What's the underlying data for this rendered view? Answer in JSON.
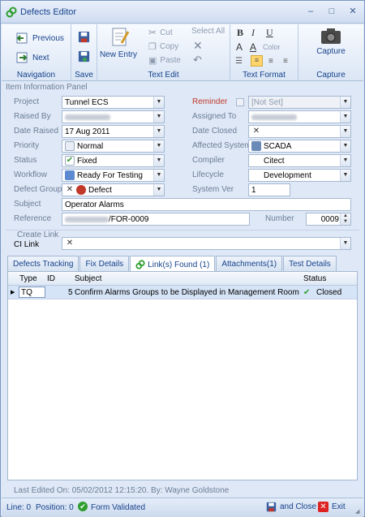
{
  "window": {
    "title": "Defects Editor",
    "controls": [
      "–",
      "□",
      "✕"
    ]
  },
  "ribbon": {
    "navigation": {
      "label": "Navigation",
      "previous": "Previous",
      "next": "Next"
    },
    "save": {
      "label": "Save"
    },
    "text_edit": {
      "label": "Text Edit",
      "new_entry": "New Entry",
      "cut": "Cut",
      "copy": "Copy",
      "paste": "Paste",
      "select_all": "Select All"
    },
    "text_format": {
      "label": "Text Format",
      "bold": "B",
      "italic": "I",
      "underline": "U",
      "color": "Color"
    },
    "capture": {
      "label": "Capture",
      "button": "Capture"
    }
  },
  "panel": {
    "title": "Item Information Panel",
    "project": {
      "label": "Project",
      "value": "Tunnel ECS"
    },
    "raised_by": {
      "label": "Raised By"
    },
    "date_raised": {
      "label": "Date Raised",
      "value": "17 Aug 2011"
    },
    "priority": {
      "label": "Priority",
      "value": "Normal"
    },
    "status": {
      "label": "Status",
      "value": "Fixed"
    },
    "workflow": {
      "label": "Workflow",
      "value": "Ready For Testing"
    },
    "defect_group": {
      "label": "Defect Group",
      "value": "Defect"
    },
    "subject": {
      "label": "Subject",
      "value": "Operator Alarms"
    },
    "reference": {
      "label": "Reference",
      "value": "/FOR-0009"
    },
    "reminder": {
      "label": "Reminder",
      "value": "[Not Set]"
    },
    "assigned_to": {
      "label": "Assigned To"
    },
    "date_closed": {
      "label": "Date Closed"
    },
    "affected_system": {
      "label": "Affected System",
      "value": "SCADA"
    },
    "compiler": {
      "label": "Compiler",
      "value": "Citect"
    },
    "lifecycle": {
      "label": "Lifecycle",
      "value": "Development"
    },
    "system_ver": {
      "label": "System Ver",
      "value": "1"
    },
    "number": {
      "label": "Number",
      "value": "0009"
    }
  },
  "link": {
    "title": "Create Link",
    "ci_label": "CI Link"
  },
  "tabs": [
    "Defects Tracking",
    "Fix Details",
    "Link(s) Found (1)",
    "Attachments(1)",
    "Test Details"
  ],
  "grid": {
    "columns": [
      "Type",
      "ID",
      "Subject",
      "Status"
    ],
    "rows": [
      {
        "type": "TQ",
        "id": "5",
        "subject": "Confirm Alarms Groups to be Displayed in Management Room",
        "status": "Closed"
      }
    ]
  },
  "footer": {
    "last_edited": "Last Edited On: 05/02/2012 12:15:20. By: Wayne Goldstone"
  },
  "statusbar": {
    "line": "Line: 0",
    "position": "Position: 0",
    "validated": "Form Validated",
    "save_close": "and Close",
    "exit": "Exit"
  },
  "colors": {
    "accent": "#15428b",
    "ok": "#2e9e2e",
    "danger": "#d22"
  }
}
